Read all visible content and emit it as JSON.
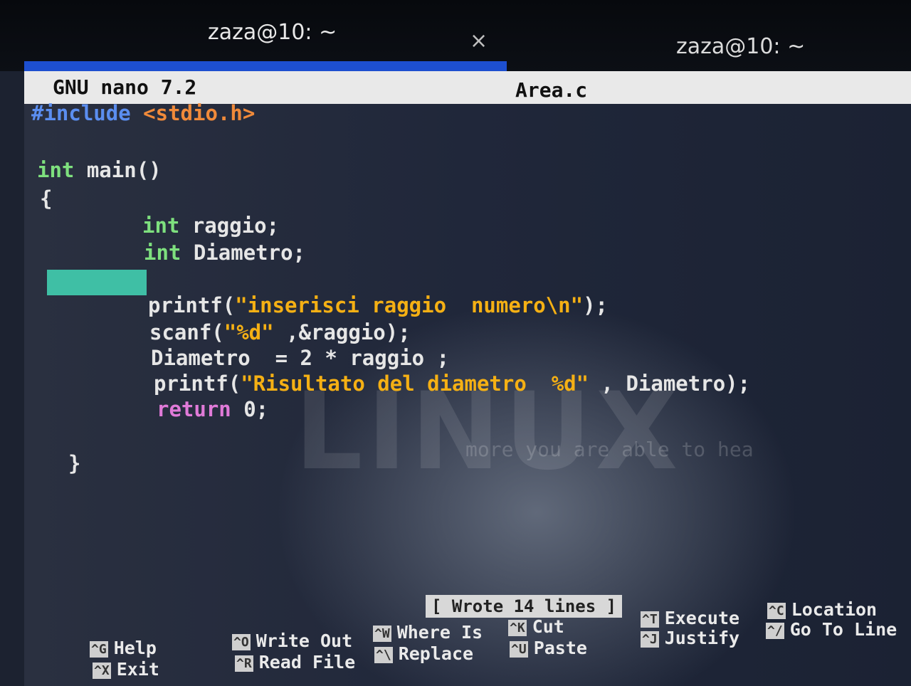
{
  "tabs": [
    {
      "title": "zaza@10: ~",
      "active": true
    },
    {
      "title": "zaza@10: ~",
      "active": false
    }
  ],
  "tab_close_glyph": "×",
  "accent_color": "#1d4fd0",
  "nano": {
    "title": "GNU nano 7.2",
    "filename": "Area.c"
  },
  "code": {
    "l1a": "#include",
    "l1b": "<stdio.h>",
    "l2a": "int",
    "l2b": " main()",
    "l3": "{",
    "l4a": "int",
    "l4b": " raggio;",
    "l5a": "int",
    "l5b": " Diametro;",
    "l6a": "printf(",
    "l6b": "\"inserisci raggio  numero\\n\"",
    "l6c": ");",
    "l7a": "scanf(",
    "l7b": "\"%d\"",
    "l7c": " ,&raggio);",
    "l8": "Diametro  = 2 * raggio ;",
    "l9a": "printf(",
    "l9b": "\"Risultato del diametro  %d\"",
    "l9c": " , Diametro);",
    "l10a": "return",
    "l10b": " 0;",
    "l11": "}"
  },
  "watermark": {
    "text": "LINUX",
    "sub": "more you are able to hea"
  },
  "status_message": "[ Wrote 14 lines ]",
  "shortcuts": [
    {
      "key1": "^G",
      "label1": "Help",
      "key2": "^X",
      "label2": "Exit"
    },
    {
      "key1": "^O",
      "label1": "Write Out",
      "key2": "^R",
      "label2": "Read File"
    },
    {
      "key1": "^W",
      "label1": "Where Is",
      "key2": "^\\",
      "label2": "Replace"
    },
    {
      "key1": "^K",
      "label1": "Cut",
      "key2": "^U",
      "label2": "Paste"
    },
    {
      "key1": "^T",
      "label1": "Execute",
      "key2": "^J",
      "label2": "Justify"
    },
    {
      "key1": "^C",
      "label1": "Location",
      "key2": "^/",
      "label2": "Go To Line"
    }
  ]
}
